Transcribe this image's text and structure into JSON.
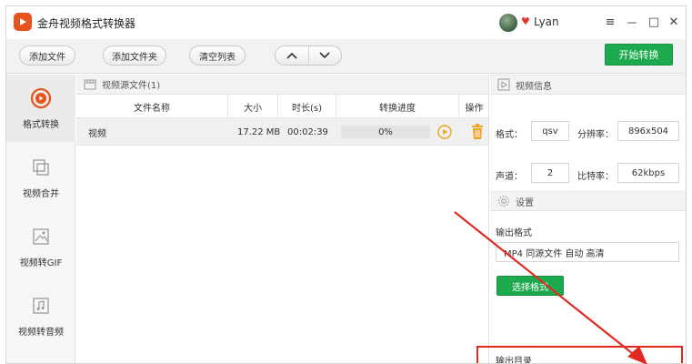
{
  "app": {
    "title": "金舟视频格式转换器",
    "user_name": "Lyan",
    "controls": {
      "menu": "≡",
      "minimize": "－",
      "maximize": "□",
      "close": "✕"
    }
  },
  "toolbar": {
    "add_file": "添加文件",
    "add_folder": "添加文件夹",
    "clear_list": "清空列表",
    "start_convert": "开始转换",
    "move_up_icon": "chevron-up-icon",
    "move_down_icon": "chevron-down-icon"
  },
  "sidebar": {
    "items": [
      {
        "label": "格式转换",
        "icon": "format-convert-icon",
        "active": true
      },
      {
        "label": "视频合并",
        "icon": "video-merge-icon",
        "active": false
      },
      {
        "label": "视频转GIF",
        "icon": "gif-image-icon",
        "active": false
      },
      {
        "label": "视频转音频",
        "icon": "music-note-icon",
        "active": false
      }
    ]
  },
  "file_panel": {
    "header": "视频源文件(1)",
    "columns": [
      "文件名称",
      "大小",
      "时长(s)",
      "转换进度",
      "操作"
    ],
    "rows": [
      {
        "name": "视频",
        "size": "17.22 MB",
        "duration": "00:02:39",
        "progress_text": "0%",
        "progress": 0
      }
    ]
  },
  "video_info": {
    "header": "视频信息",
    "format_label": "格式：",
    "format_value": "qsv",
    "resolution_label": "分辨率：",
    "resolution_value": "896x504",
    "channels_label": "声道：",
    "channels_value": "2",
    "bitrate_label": "比特率：",
    "bitrate_value": "62kbps"
  },
  "settings": {
    "header": "设置",
    "output_format_label": "输出格式",
    "output_format_value": "MP4 同源文件 自动 高清",
    "choose_format_button": "选择格式",
    "output_dir_label": "输出目录"
  },
  "colors": {
    "accent_green": "#1daa4f",
    "logo_orange": "#e8531c",
    "annotation_red": "#e02a1f",
    "icon_orange": "#f0a020"
  }
}
